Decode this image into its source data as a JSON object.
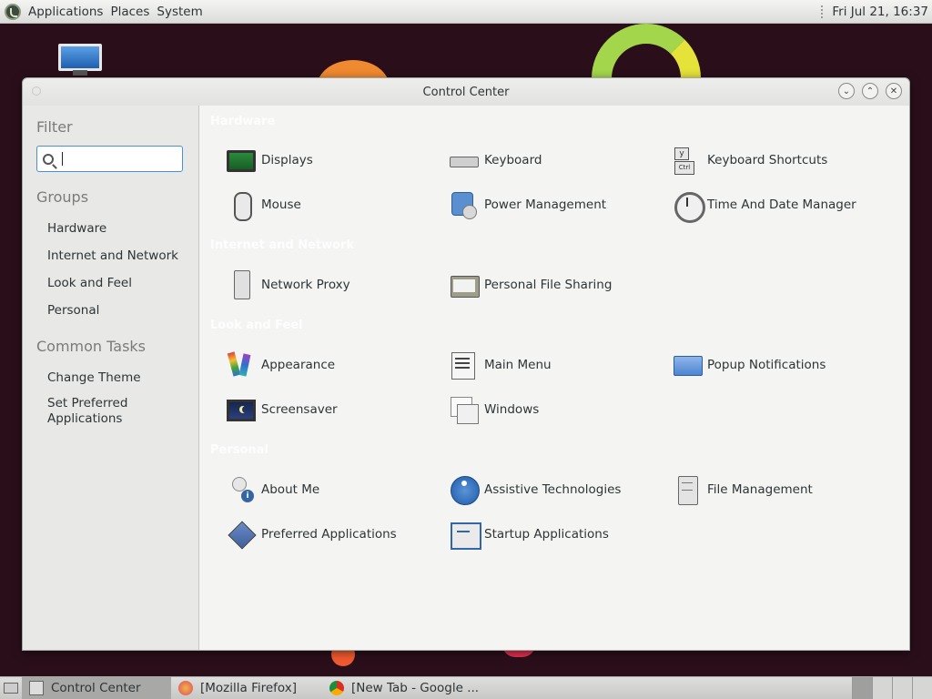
{
  "top_panel": {
    "menu": [
      "Applications",
      "Places",
      "System"
    ],
    "clock": "Fri Jul 21, 16:37"
  },
  "window": {
    "title": "Control Center",
    "buttons": [
      "minimize",
      "maximize",
      "close"
    ]
  },
  "sidebar": {
    "filter_heading": "Filter",
    "search_value": "",
    "groups_heading": "Groups",
    "groups": [
      "Hardware",
      "Internet and Network",
      "Look and Feel",
      "Personal"
    ],
    "common_heading": "Common Tasks",
    "common": [
      "Change Theme",
      "Set Preferred Applications"
    ]
  },
  "main": {
    "categories": [
      {
        "header": "Hardware",
        "items": [
          {
            "label": "Displays",
            "icon": "displays-icon"
          },
          {
            "label": "Keyboard",
            "icon": "keyboard-icon"
          },
          {
            "label": "Keyboard Shortcuts",
            "icon": "keyboard-shortcuts-icon"
          },
          {
            "label": "Mouse",
            "icon": "mouse-icon"
          },
          {
            "label": "Power Management",
            "icon": "power-management-icon"
          },
          {
            "label": "Time And Date Manager",
            "icon": "clock-icon"
          }
        ]
      },
      {
        "header": "Internet and Network",
        "items": [
          {
            "label": "Network Proxy",
            "icon": "network-proxy-icon"
          },
          {
            "label": "Personal File Sharing",
            "icon": "file-sharing-icon"
          }
        ]
      },
      {
        "header": "Look and Feel",
        "items": [
          {
            "label": "Appearance",
            "icon": "appearance-icon"
          },
          {
            "label": "Main Menu",
            "icon": "main-menu-icon"
          },
          {
            "label": "Popup Notifications",
            "icon": "popup-notifications-icon"
          },
          {
            "label": "Screensaver",
            "icon": "screensaver-icon"
          },
          {
            "label": "Windows",
            "icon": "windows-icon"
          }
        ]
      },
      {
        "header": "Personal",
        "items": [
          {
            "label": "About Me",
            "icon": "about-me-icon"
          },
          {
            "label": "Assistive Technologies",
            "icon": "assistive-technologies-icon"
          },
          {
            "label": "File Management",
            "icon": "file-management-icon"
          },
          {
            "label": "Preferred Applications",
            "icon": "preferred-applications-icon"
          },
          {
            "label": "Startup Applications",
            "icon": "startup-applications-icon"
          }
        ]
      }
    ]
  },
  "taskbar": {
    "tasks": [
      "Control Center",
      "[Mozilla Firefox]",
      "[New Tab - Google ..."
    ]
  }
}
